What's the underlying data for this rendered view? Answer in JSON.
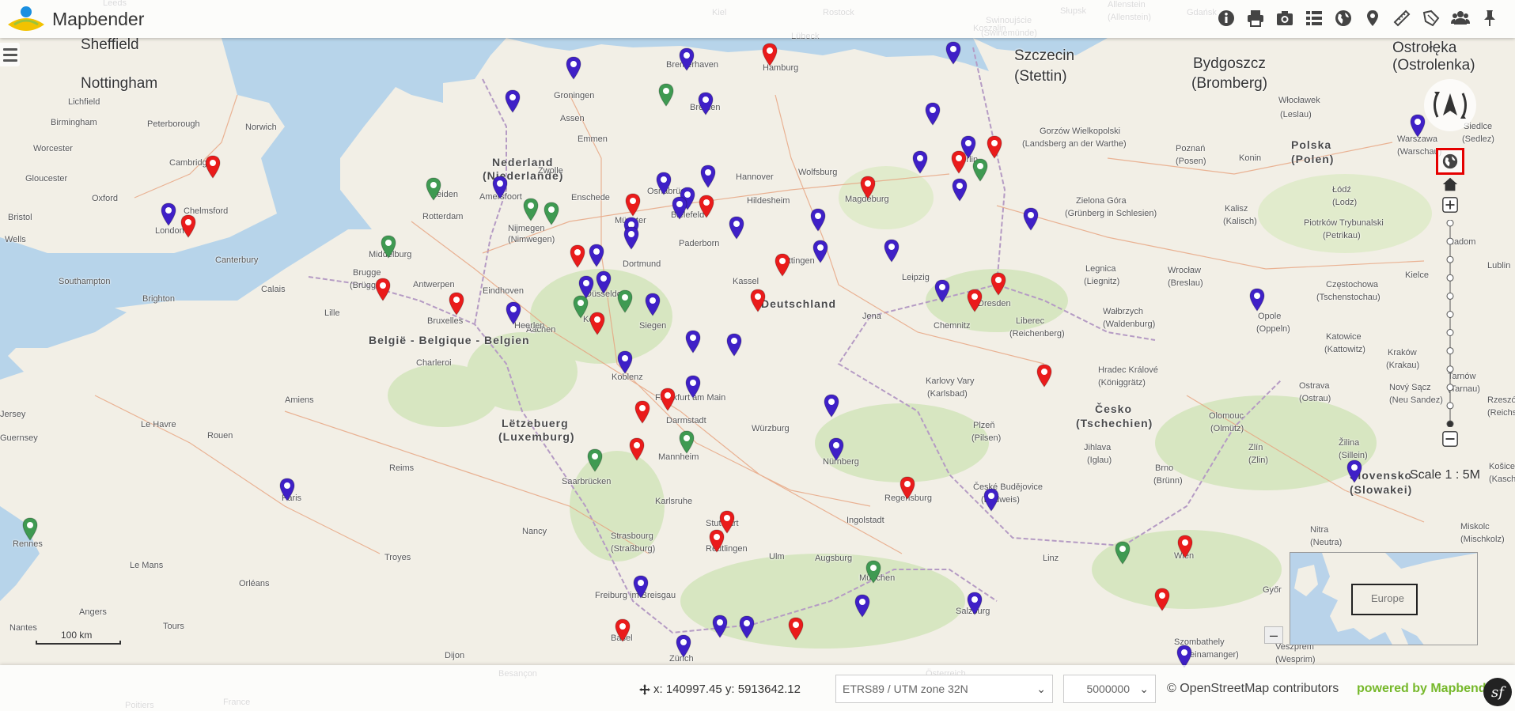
{
  "app": {
    "title": "Mapbender"
  },
  "toolbar": {
    "tools": [
      {
        "name": "about-button",
        "icon": "info-icon"
      },
      {
        "name": "print-button",
        "icon": "printer-icon"
      },
      {
        "name": "image-export-button",
        "icon": "camera-icon"
      },
      {
        "name": "layertree-button",
        "icon": "layers-list-icon"
      },
      {
        "name": "wms-loader-button",
        "icon": "globe-icon"
      },
      {
        "name": "poi-button",
        "icon": "map-marker-icon"
      },
      {
        "name": "measure-line-button",
        "icon": "ruler-line-icon"
      },
      {
        "name": "measure-area-button",
        "icon": "ruler-area-icon"
      },
      {
        "name": "user-button",
        "icon": "users-icon"
      },
      {
        "name": "pin-button",
        "icon": "thumbtack-icon"
      }
    ]
  },
  "map_labels": {
    "countries": [
      "Nederland",
      "(Niederlande)",
      "België - Belgique - Belgien",
      "Lëtzebuerg",
      "(Luxemburg)",
      "Deutschland",
      "Česko",
      "(Tschechien)",
      "Polska",
      "(Polen)",
      "Slovensko",
      "(Slowakei)"
    ],
    "cities": [
      "Leeds",
      "Sheffield",
      "Nottingham",
      "Lichfield",
      "Birmingham",
      "Peterborough",
      "Norwich",
      "Worcester",
      "Cambridge",
      "Gloucester",
      "Oxford",
      "Chelmsford",
      "Bristol",
      "London",
      "Wells",
      "Canterbury",
      "Southampton",
      "Brighton",
      "Groningen",
      "Assen",
      "Emmen",
      "Bremerhaven",
      "Bremen",
      "Hamburg",
      "Leiden",
      "Rotterdam",
      "Amersfoort",
      "Nijmegen",
      "(Nimwegen)",
      "Enschede",
      "Osnabrück",
      "Münster",
      "Bielefeld",
      "Hannover",
      "Hildesheim",
      "Wolfsburg",
      "Magdeburg",
      "Berlin",
      "Middelburg",
      "Eindhoven",
      "Paderborn",
      "Göttingen",
      "Kassel",
      "Brugge",
      "(Brügge)",
      "Antwerpen",
      "Dortmund",
      "Düsseldorf",
      "Köln",
      "Aachen",
      "Heerlen",
      "Siegen",
      "Leipzig",
      "Chemnitz",
      "Dresden",
      "Jena",
      "Charleroi",
      "Koblenz",
      "Frankfurt am Main",
      "Darmstadt",
      "Würzburg",
      "Amiens",
      "Le Havre",
      "Rouen",
      "Reims",
      "Mannheim",
      "Saarbrücken",
      "Nürnberg",
      "Karlsruhe",
      "Paris",
      "Nancy",
      "Strasbourg",
      "(Straßburg)",
      "Stuttgart",
      "Reutlingen",
      "Ulm",
      "Augsburg",
      "Ingolstadt",
      "Regensburg",
      "München",
      "Rennes",
      "Le Mans",
      "Troyes",
      "Orléans",
      "Freiburg im Breisgau",
      "Angers",
      "Tours",
      "Nantes",
      "Dijon",
      "Basel",
      "Zürich",
      "Salzburg",
      "Linz",
      "Wien",
      "Szczecin",
      "(Stettin)",
      "Bydgoszcz",
      "(Bromberg)",
      "Ostrołęka",
      "(Ostrolenka)",
      "Włocławek",
      "(Leslau)",
      "Siedlce",
      "(Sedlez)",
      "Gorzów Wielkopolski",
      "(Landsberg an der Warthe)",
      "Poznań",
      "(Posen)",
      "Konin",
      "Warszawa",
      "(Warschau)",
      "Zielona Góra",
      "(Grünberg in Schlesien)",
      "Kalisz",
      "(Kalisch)",
      "Łódź",
      "(Lodz)",
      "Piotrków Trybunalski",
      "(Petrikau)",
      "Kielce",
      "Legnica",
      "(Liegnitz)",
      "Wrocław",
      "(Breslau)",
      "Częstochowa",
      "(Tschenstochau)",
      "Liberec",
      "(Reichenberg)",
      "Wałbrzych",
      "(Waldenburg)",
      "Opole",
      "(Oppeln)",
      "Katowice",
      "(Kattowitz)",
      "Kraków",
      "(Krakau)",
      "Karlovy Vary",
      "(Karlsbad)",
      "Hradec Králové",
      "(Königgrätz)",
      "Ostrava",
      "(Ostrau)",
      "Plzeň",
      "(Pilsen)",
      "Olomouc",
      "(Olmütz)",
      "Jihlava",
      "(Iglau)",
      "Zlín",
      "(Zlin)",
      "Brno",
      "(Brünn)",
      "Žilina",
      "(Sillein)",
      "České Budějovice",
      "(Budweis)",
      "Nitra",
      "(Neutra)",
      "Győr",
      "Szombathely",
      "(Steinamanger)",
      "Veszprém",
      "(Wesprim)",
      "Miskolc",
      "(Mischkolz)",
      "Košice",
      "(Kaschau)",
      "Nový Sącz",
      "(Neu Sandez)",
      "Poitiers",
      "France",
      "Besançon",
      "Österreich",
      "Jersey",
      "Guernsey",
      "Bruxelles",
      "Lille",
      "Calais",
      "Zwolle",
      "Rzeszów",
      "(Reichshof)",
      "Tarnów",
      "(Tarnau)",
      "Radom",
      "Lublin",
      "Allenstein",
      "(Allenstein)",
      "Koszalin",
      "Słupsk",
      "Gdańsk",
      "Swinoujście",
      "(Swinemünde)",
      "Lübeck",
      "Rostock",
      "Kiel"
    ]
  },
  "navigation": {
    "rotate_icon": "rotate-north-icon",
    "globe_icon": "globe-icon",
    "home_icon": "home-icon",
    "zoom_in_icon": "plus-icon",
    "zoom_out_icon": "minus-icon",
    "zoom_steps": 12,
    "current_zoom_step": 12
  },
  "scale_display": "Scale 1 : 5M",
  "scalebar": {
    "label": "100 km"
  },
  "overview": {
    "label": "Europe",
    "toggle_label": "–"
  },
  "footer": {
    "coordinates": "x: 140997.45 y: 5913642.12",
    "coordinates_icon": "move-crosshair-icon",
    "srs_value": "ETRS89 / UTM zone 32N",
    "scale_value": "5000000",
    "attribution": "© OpenStreetMap contributors",
    "powered_by": "powered by Mapbender",
    "symfony_icon": "symfony-icon"
  },
  "colors": {
    "marker_blue": "#3f20c7",
    "marker_red": "#ea1b1b",
    "marker_green": "#3f9a52",
    "sea": "#b7d4ea",
    "land": "#f2efe6",
    "forest": "#d7e6c1",
    "highlight": "#e50000",
    "brand_green": "#76b82a"
  }
}
